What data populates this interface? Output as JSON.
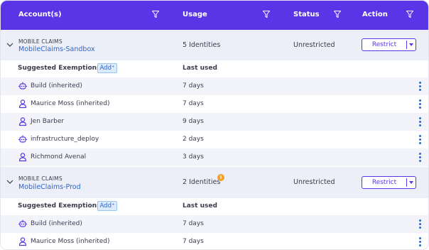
{
  "header": {
    "accounts_label": "Account(s)",
    "usage_label": "Usage",
    "status_label": "Status",
    "action_label": "Action",
    "filter_icon": "funnel-icon",
    "background_color": "#5a35e8"
  },
  "accounts": [
    {
      "category": "MOBILE CLAIMS",
      "name": "MobileClaims-Sandbox",
      "usage": "5 Identities",
      "status": "Unrestricted",
      "action_label": "Restrict",
      "has_warning": false,
      "suggested_label": "Suggested Exemptions",
      "add_label": "Add⁺",
      "last_used_label": "Last used",
      "items": [
        {
          "icon": "robot-icon",
          "name": "Build (inherited)",
          "last_used": "7 days"
        },
        {
          "icon": "user-icon",
          "name": "Maurice Moss (inherited)",
          "last_used": "7 days"
        },
        {
          "icon": "user-icon",
          "name": "Jen Barber",
          "last_used": "9 days"
        },
        {
          "icon": "robot-icon",
          "name": "infrastructure_deploy",
          "last_used": "2 days"
        },
        {
          "icon": "user-icon",
          "name": "Richmond Avenal",
          "last_used": "3 days"
        }
      ]
    },
    {
      "category": "MOBILE CLAIMS",
      "name": "MobileClaims-Prod",
      "usage": "2 Identities",
      "status": "Unrestricted",
      "action_label": "Restrict",
      "has_warning": true,
      "warning_glyph": "!",
      "suggested_label": "Suggested Exemptions",
      "add_label": "Add⁺",
      "last_used_label": "Last used",
      "items": [
        {
          "icon": "robot-icon",
          "name": "Build (inherited)",
          "last_used": "7 days"
        },
        {
          "icon": "user-icon",
          "name": "Maurice Moss (inherited)",
          "last_used": "7 days"
        }
      ]
    }
  ],
  "colors": {
    "accent": "#5a35e8",
    "link": "#2f66c8",
    "warning": "#f0a22a"
  }
}
